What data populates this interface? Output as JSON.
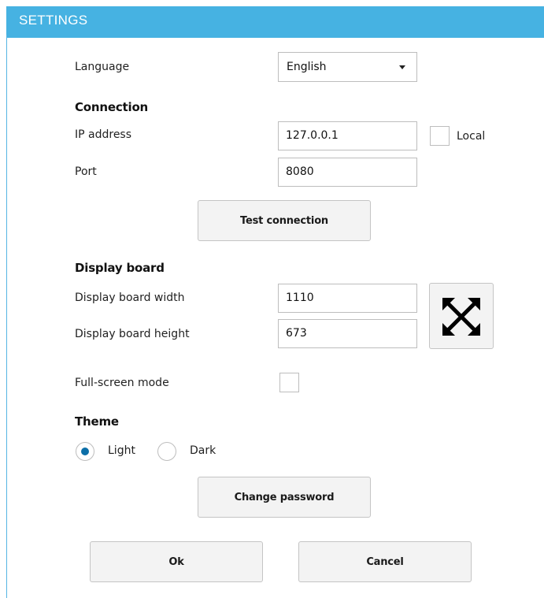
{
  "window": {
    "title": "SETTINGS"
  },
  "language": {
    "label": "Language",
    "selected": "English"
  },
  "connection": {
    "heading": "Connection",
    "ip_label": "IP address",
    "ip_value": "127.0.0.1",
    "local_label": "Local",
    "local_checked": false,
    "port_label": "Port",
    "port_value": "8080",
    "test_button": "Test connection"
  },
  "display_board": {
    "heading": "Display board",
    "width_label": "Display board width",
    "width_value": "1110",
    "height_label": "Display board height",
    "height_value": "673",
    "fullscreen_icon": "expand-arrows-icon"
  },
  "fullscreen_mode": {
    "label": "Full-screen mode",
    "checked": false
  },
  "theme": {
    "heading": "Theme",
    "options": [
      {
        "label": "Light",
        "selected": true
      },
      {
        "label": "Dark",
        "selected": false
      }
    ]
  },
  "buttons": {
    "change_password": "Change password",
    "ok": "Ok",
    "cancel": "Cancel"
  },
  "colors": {
    "titlebar": "#46b2e2",
    "radio_selected": "#0c6fa8"
  }
}
